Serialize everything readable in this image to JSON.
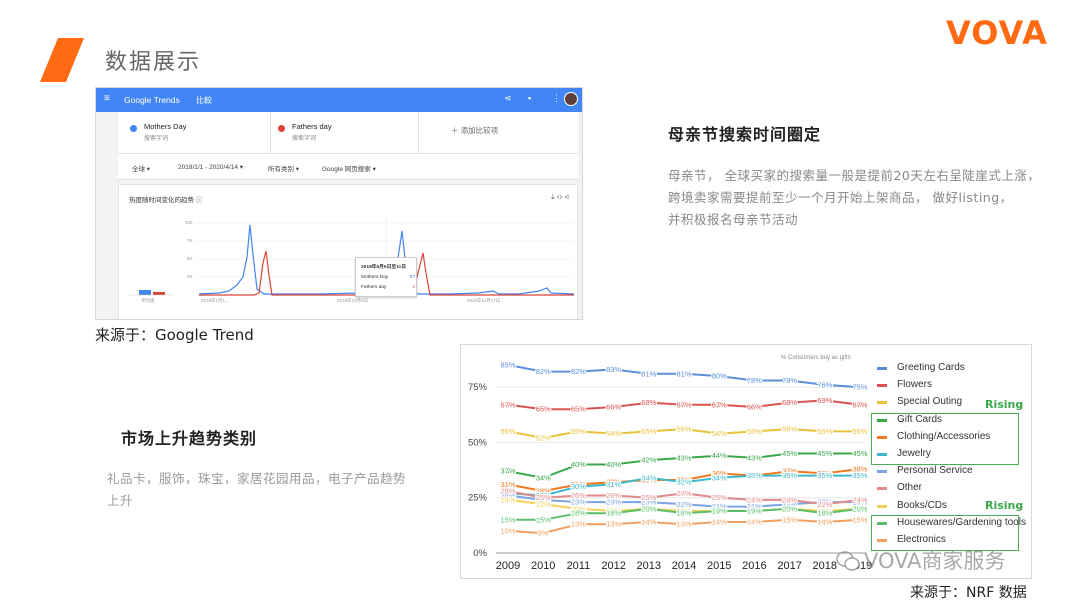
{
  "slide": {
    "title": "数据展示",
    "brand": "VOVA",
    "accent_color": "#ff6a13"
  },
  "trends": {
    "brand": "Google Trends",
    "mode": "比較",
    "icons": [
      "share-icon",
      "feedback-icon",
      "apps-icon",
      "avatar"
    ],
    "terms": [
      {
        "name": "Mothers Day",
        "sub": "搜索字词",
        "color": "#4285f4"
      },
      {
        "name": "Fathers day",
        "sub": "搜索字词",
        "color": "#db4437"
      }
    ],
    "add_term": "＋  添加比较项",
    "filters": {
      "region": "全球  ▾",
      "range": "2018/1/1 - 2020/4/14  ▾",
      "category": "所有类别  ▾",
      "source": "Google 网页搜索  ▾"
    },
    "card_title": "热度随时间变化的趋势  ⓘ",
    "card_icons": "⤓  ‹›  ⋖",
    "y_ticks": [
      "100",
      "75",
      "50",
      "25"
    ],
    "x_ticks": [
      "2018年1月1...",
      "2018年12月9日",
      "2019年11月17日"
    ],
    "avg_label": "平均值",
    "tooltip": {
      "date": "2019年5月5日至11日",
      "rows": [
        {
          "name": "Mothers Day",
          "value": "87",
          "color": "#4285f4"
        },
        {
          "name": "Fathers day",
          "value": "4",
          "color": "#db4437"
        }
      ]
    }
  },
  "source1": "来源于：Google Trend",
  "right_block": {
    "heading": "母亲节搜索时间圈定",
    "lines": [
      "母亲节，  全球买家的搜索量一般是提前20天左右呈陡崖式上涨，",
      "跨境卖家需要提前至少一个月开始上架商品，  做好listing，",
      "并积极报名母亲节活动"
    ]
  },
  "left_block": {
    "heading": "市场上升趋势类别",
    "lines": [
      "礼品卡，服饰，珠宝，家居花园用品，电子产品趋势",
      "上升"
    ]
  },
  "chart_data": {
    "type": "line",
    "title": "",
    "note": "% Consumers buy as gifts",
    "xlabel": "",
    "ylabel": "",
    "x": [
      "2009",
      "2010",
      "2011",
      "2012",
      "2013",
      "2014",
      "2015",
      "2016",
      "2017",
      "2018",
      "2019"
    ],
    "ylim": [
      0,
      85
    ],
    "y_ticks": [
      "0%",
      "25%",
      "50%",
      "75%"
    ],
    "legend_position": "right",
    "series": [
      {
        "name": "Greeting Cards",
        "color": "#5b8fd9",
        "values": [
          85,
          82,
          82,
          83,
          81,
          81,
          80,
          78,
          78,
          76,
          75
        ]
      },
      {
        "name": "Flowers",
        "color": "#d9534f",
        "values": [
          67,
          65,
          65,
          66,
          68,
          67,
          67,
          66,
          68,
          69,
          67
        ]
      },
      {
        "name": "Special Outing",
        "color": "#e8c33a",
        "values": [
          55,
          52,
          55,
          54,
          55,
          56,
          54,
          55,
          56,
          55,
          55
        ]
      },
      {
        "name": "Gift Cards",
        "color": "#3aa84a",
        "values": [
          37,
          34,
          40,
          40,
          42,
          43,
          44,
          43,
          45,
          45,
          45
        ]
      },
      {
        "name": "Clothing/Accessories",
        "color": "#f07a20",
        "values": [
          31,
          28,
          31,
          32,
          33,
          33,
          36,
          35,
          37,
          36,
          38
        ]
      },
      {
        "name": "Jewelry",
        "color": "#3fb8c9",
        "values": [
          27,
          26,
          30,
          31,
          34,
          32,
          34,
          35,
          35,
          35,
          35
        ]
      },
      {
        "name": "Personal Service",
        "color": "#7aa3e0",
        "values": [
          26,
          24,
          23,
          23,
          23,
          22,
          21,
          21,
          22,
          23,
          23
        ]
      },
      {
        "name": "Other",
        "color": "#e08a8a",
        "values": [
          28,
          25,
          26,
          26,
          25,
          27,
          25,
          24,
          24,
          22,
          24
        ]
      },
      {
        "name": "Books/CDs",
        "color": "#f2d15a",
        "values": [
          24,
          22,
          20,
          19,
          20,
          19,
          19,
          19,
          20,
          19,
          20
        ]
      },
      {
        "name": "Housewares/Gardening tools",
        "color": "#5bbf6a",
        "values": [
          15,
          15,
          18,
          18,
          20,
          18,
          19,
          19,
          20,
          18,
          20
        ]
      },
      {
        "name": "Electronics",
        "color": "#f0a060",
        "values": [
          10,
          9,
          13,
          13,
          14,
          13,
          14,
          14,
          15,
          14,
          15
        ]
      }
    ],
    "rising_label": "Rising"
  },
  "watermark": "VOVA商家服务",
  "source2": "来源于：NRF 数据"
}
